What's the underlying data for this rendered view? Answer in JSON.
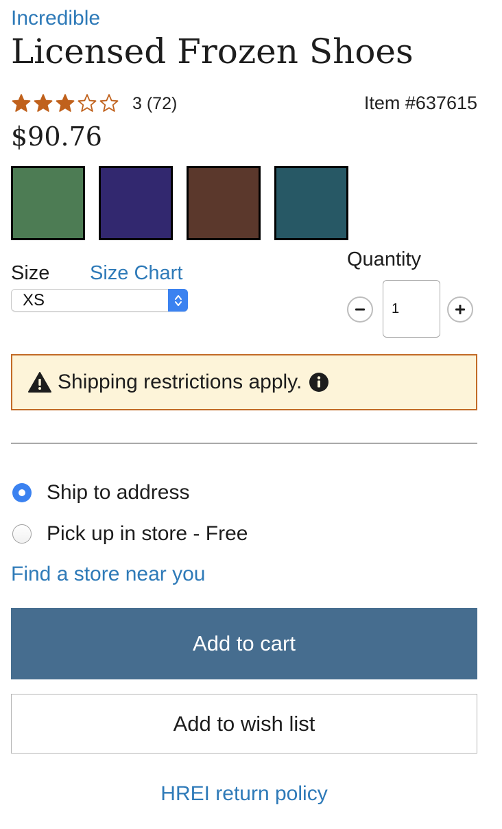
{
  "product": {
    "brand": "Incredible",
    "title": "Licensed Frozen Shoes",
    "rating": 3,
    "rating_max": 5,
    "rating_text": "3 (72)",
    "item_number": "Item #637615",
    "price": "$90.76"
  },
  "colors": {
    "link": "#2e7ab8",
    "star": "#c0611c",
    "cart_button": "#466d8f",
    "alert_bg": "#fdf4d9",
    "alert_border": "#c26a26",
    "radio_checked": "#3b82f0"
  },
  "swatches": [
    "#4d7c54",
    "#32286f",
    "#5b382c",
    "#275865"
  ],
  "size": {
    "label": "Size",
    "chart_link": "Size Chart",
    "selected": "XS"
  },
  "quantity": {
    "label": "Quantity",
    "value": "1"
  },
  "alert": {
    "text": "Shipping restrictions apply.",
    "icon": "warning-icon",
    "info_icon": "info-icon"
  },
  "fulfillment": {
    "options": [
      {
        "label": "Ship to address",
        "selected": true
      },
      {
        "label": "Pick up in store - Free",
        "selected": false
      }
    ],
    "find_store": "Find a store near you"
  },
  "actions": {
    "add_to_cart": "Add to cart",
    "add_to_wish_list": "Add to wish list",
    "return_policy": "HREI return policy"
  }
}
